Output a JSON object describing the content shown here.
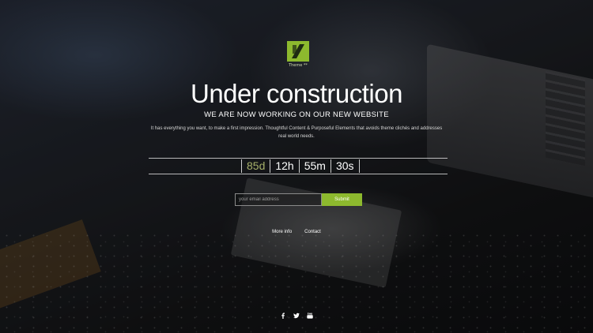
{
  "logo": {
    "text": "Theme **"
  },
  "hero": {
    "title": "Under construction",
    "subtitle": "WE ARE NOW WORKING ON OUR NEW WEBSITE",
    "description": "It has everything you want, to make a first impression. Thoughtful Content & Purposeful Elements that avoids theme clichés and addresses real world needs."
  },
  "countdown": {
    "days": "85d",
    "hours": "12h",
    "minutes": "55m",
    "seconds": "30s",
    "days_color": "#a6b06a"
  },
  "subscribe": {
    "email_placeholder": "your email address",
    "submit_label": "Submit",
    "accent_color": "#8db92e"
  },
  "links": {
    "more_info": "More info",
    "contact": "Contact"
  },
  "social": [
    "facebook-icon",
    "twitter-icon",
    "youtube-icon"
  ]
}
